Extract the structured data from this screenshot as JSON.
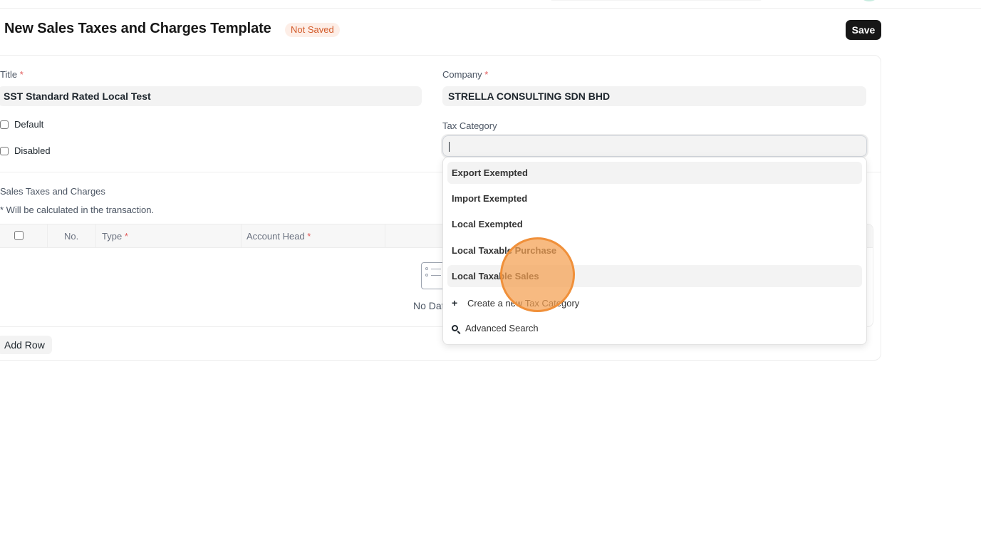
{
  "page": {
    "title": "New Sales Taxes and Charges Template",
    "status": "Not Saved",
    "save_label": "Save"
  },
  "form": {
    "title_label": "Title",
    "required_mark": "*",
    "title_value": "SST Standard Rated Local Test",
    "company_label": "Company",
    "company_value": "STRELLA CONSULTING SDN BHD",
    "default_label": "Default",
    "disabled_label": "Disabled",
    "tax_category_label": "Tax Category",
    "tax_category_value": ""
  },
  "taxes": {
    "section_label": "Sales Taxes and Charges",
    "note": "* Will be calculated in the transaction.",
    "columns": {
      "no": "No.",
      "type": "Type",
      "account_head": "Account Head"
    },
    "empty_text": "No Data",
    "add_row_label": "Add Row"
  },
  "dropdown": {
    "options": [
      "Export Exempted",
      "Import Exempted",
      "Local Exempted",
      "Local Taxable Purchase",
      "Local Taxable Sales"
    ],
    "create_label": "Create a new Tax Category",
    "advanced_search_label": "Advanced Search",
    "create_icon": "plus-icon",
    "search_icon": "search-icon"
  },
  "colors": {
    "status_badge": "#d35b2a",
    "click_marker": "#f0903a"
  }
}
